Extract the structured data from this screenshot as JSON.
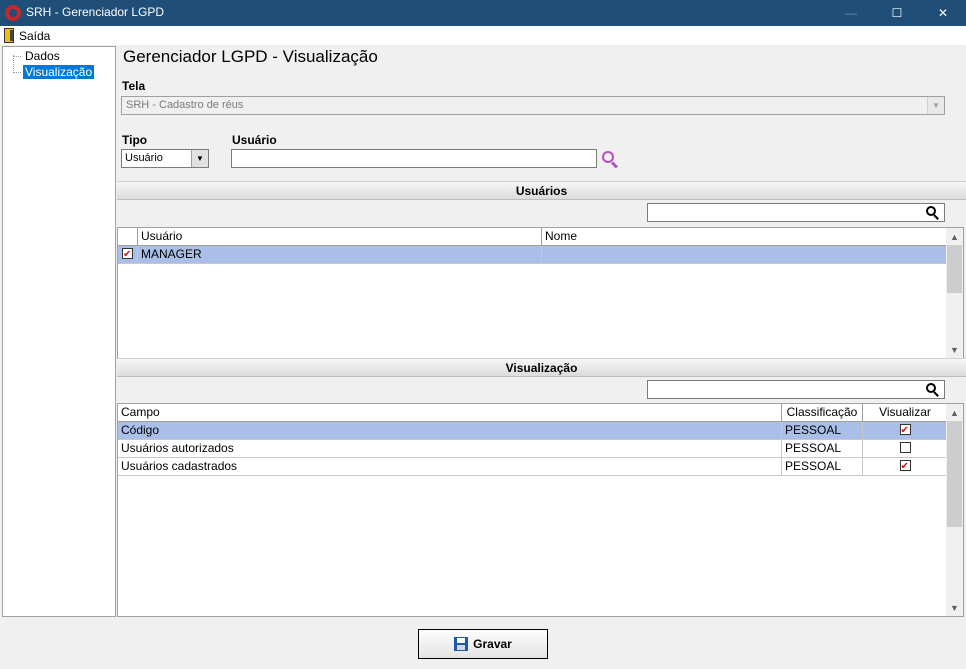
{
  "window": {
    "title": "SRH - Gerenciador LGPD",
    "min_glyph": "—",
    "max_glyph": "☐",
    "close_glyph": "✕"
  },
  "menu": {
    "exit_label": "Saída"
  },
  "tree": {
    "items": [
      {
        "label": "Dados"
      },
      {
        "label": "Visualização",
        "selected": true
      }
    ]
  },
  "page": {
    "title": "Gerenciador LGPD - Visualização"
  },
  "form": {
    "tela_label": "Tela",
    "tela_value": "SRH - Cadastro de réus",
    "tipo_label": "Tipo",
    "tipo_value": "Usuário",
    "usuario_label": "Usuário",
    "usuario_value": ""
  },
  "usuarios": {
    "header": "Usuários",
    "search_value": "",
    "columns": [
      "Usuário",
      "Nome"
    ],
    "rows": [
      {
        "checked": true,
        "usuario": "MANAGER",
        "nome": "",
        "selected": true
      }
    ]
  },
  "visualizacao": {
    "header": "Visualização",
    "search_value": "",
    "columns": [
      "Campo",
      "Classificação",
      "Visualizar"
    ],
    "rows": [
      {
        "campo": "Código",
        "classificacao": "PESSOAL",
        "visualizar": true,
        "selected": true
      },
      {
        "campo": "Usuários autorizados",
        "classificacao": "PESSOAL",
        "visualizar": false
      },
      {
        "campo": "Usuários cadastrados",
        "classificacao": "PESSOAL",
        "visualizar": true
      }
    ]
  },
  "actions": {
    "save_label": "Gravar"
  },
  "icons": {
    "app": "srh-logo-icon",
    "exit": "exit-door-icon",
    "lookup": "magnifier-purple-icon",
    "search": "magnifier-icon",
    "save": "floppy-disk-icon"
  },
  "colors": {
    "titlebar": "#1f4e79",
    "selection": "#0078d7",
    "row_selected": "#aabfe8",
    "check_mark": "#dd1111"
  }
}
